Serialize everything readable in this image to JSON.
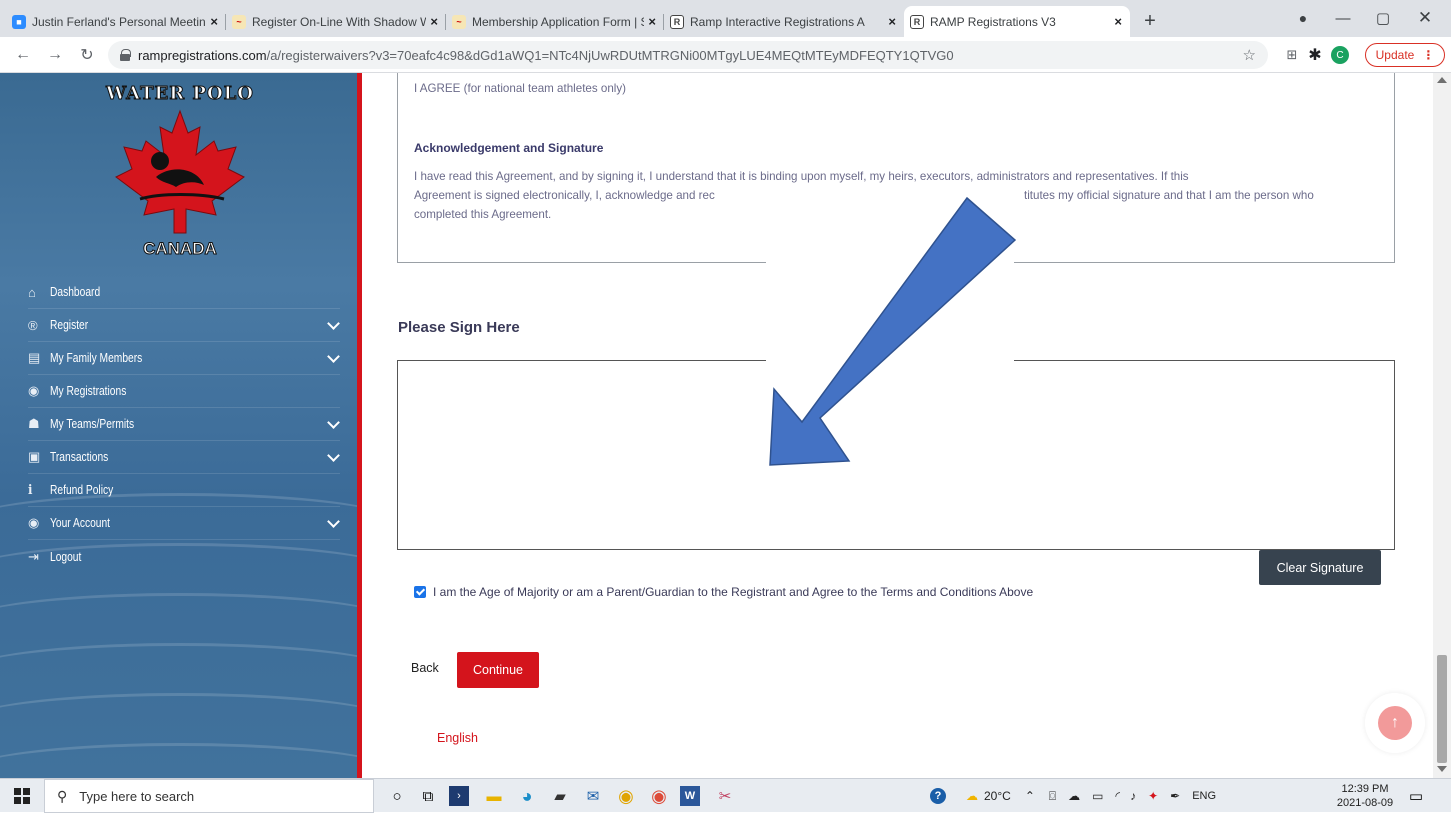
{
  "browser": {
    "tabs": [
      {
        "title": "Justin Ferland's Personal Meeting",
        "favicon": "zoom-icon"
      },
      {
        "title": "Register On-Line With Shadow W",
        "favicon": "waterpolo-icon"
      },
      {
        "title": "Membership Application Form | S",
        "favicon": "waterpolo-icon"
      },
      {
        "title": "Ramp Interactive Registrations A",
        "favicon": "ramp-icon"
      },
      {
        "title": "RAMP Registrations V3",
        "favicon": "ramp-icon"
      }
    ],
    "close_glyph": "×",
    "newtab_glyph": "+",
    "url_domain": "rampregistrations.com",
    "url_path": "/a/registerwaivers?v3=70eafc4c98&dGd1aWQ1=NTc4NjUwRDUtMTRGNi00MTgyLUE4MEQtMTEyMDFEQTY1QTVG0",
    "profile_initial": "C",
    "update_label": "Update"
  },
  "sidebar": {
    "logo_top": "WATER POLO",
    "logo_bottom": "CANADA",
    "items": [
      {
        "label": "Dashboard",
        "icon": "home-icon",
        "glyph": "⌂",
        "expand": false
      },
      {
        "label": "Register",
        "icon": "register-icon",
        "glyph": "®",
        "expand": true
      },
      {
        "label": "My Family Members",
        "icon": "id-card-icon",
        "glyph": "▤",
        "expand": true
      },
      {
        "label": "My Registrations",
        "icon": "user-circle-icon",
        "glyph": "◉",
        "expand": false
      },
      {
        "label": "My Teams/Permits",
        "icon": "users-icon",
        "glyph": "☗",
        "expand": true
      },
      {
        "label": "Transactions",
        "icon": "money-icon",
        "glyph": "▣",
        "expand": true
      },
      {
        "label": "Refund Policy",
        "icon": "info-icon",
        "glyph": "i",
        "expand": false
      },
      {
        "label": "Your Account",
        "icon": "user-circle-icon",
        "glyph": "◉",
        "expand": true
      },
      {
        "label": "Logout",
        "icon": "logout-icon",
        "glyph": "⇥",
        "expand": false
      }
    ]
  },
  "main": {
    "agree_option": "I AGREE (for national team athletes only)",
    "ack_title": "Acknowledgement and Signature",
    "ack_line1": "I have read this Agreement, and by signing it, I understand that it is binding upon myself, my heirs, executors, administrators and representatives. If this",
    "ack_line2a": "Agreement is signed electronically, I, acknowledge and rec",
    "ack_line2b": "titutes my official signature and that I am the person who",
    "ack_line3": "completed this Agreement.",
    "sign_heading": "Please Sign Here",
    "clear_signature": "Clear Signature",
    "agree_checkbox": "I am the Age of Majority or am a Parent/Guardian to the Registrant and Agree to the Terms and Conditions Above",
    "agree_checked": true,
    "back_label": "Back",
    "continue_label": "Continue",
    "language": "English",
    "to_top_glyph": "↑"
  },
  "annotation": {
    "color": "#4472c4"
  },
  "taskbar": {
    "search_placeholder": "Type here to search",
    "weather": "20°C",
    "lang": "ENG",
    "time": "12:39 PM",
    "date": "2021-08-09"
  },
  "colors": {
    "accent_red": "#d4141c",
    "dark_button": "#37434f",
    "checkbox_blue": "#1a73e8"
  }
}
